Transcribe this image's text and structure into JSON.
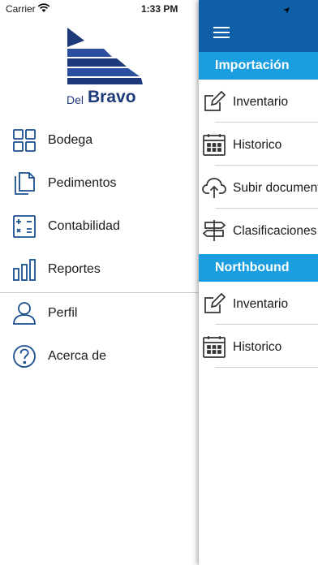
{
  "status_bar": {
    "carrier": "Carrier",
    "time": "1:33 PM"
  },
  "brand": {
    "name_small": "Del",
    "name_large": "Bravo",
    "color": "#1f3a7a"
  },
  "drawer_menu": {
    "items": [
      {
        "label": "Bodega",
        "icon": "grid-icon"
      },
      {
        "label": "Pedimentos",
        "icon": "documents-icon"
      },
      {
        "label": "Contabilidad",
        "icon": "calculator-icon"
      },
      {
        "label": "Reportes",
        "icon": "bar-chart-icon"
      },
      {
        "label": "Perfil",
        "icon": "user-icon"
      },
      {
        "label": "Acerca de",
        "icon": "help-icon"
      }
    ]
  },
  "panel": {
    "bar_color": "#0f5ea8",
    "section_color": "#1a9ee0",
    "sections": [
      {
        "title": "Importación",
        "items": [
          {
            "label": "Inventario",
            "icon": "edit-icon"
          },
          {
            "label": "Historico",
            "icon": "calendar-icon"
          },
          {
            "label": "Subir documentos",
            "icon": "cloud-upload-icon"
          },
          {
            "label": "Clasificaciones",
            "icon": "signpost-icon"
          }
        ]
      },
      {
        "title": "Northbound",
        "items": [
          {
            "label": "Inventario",
            "icon": "edit-icon"
          },
          {
            "label": "Historico",
            "icon": "calendar-icon"
          }
        ]
      }
    ]
  },
  "icon_color": "#1a4f8f"
}
